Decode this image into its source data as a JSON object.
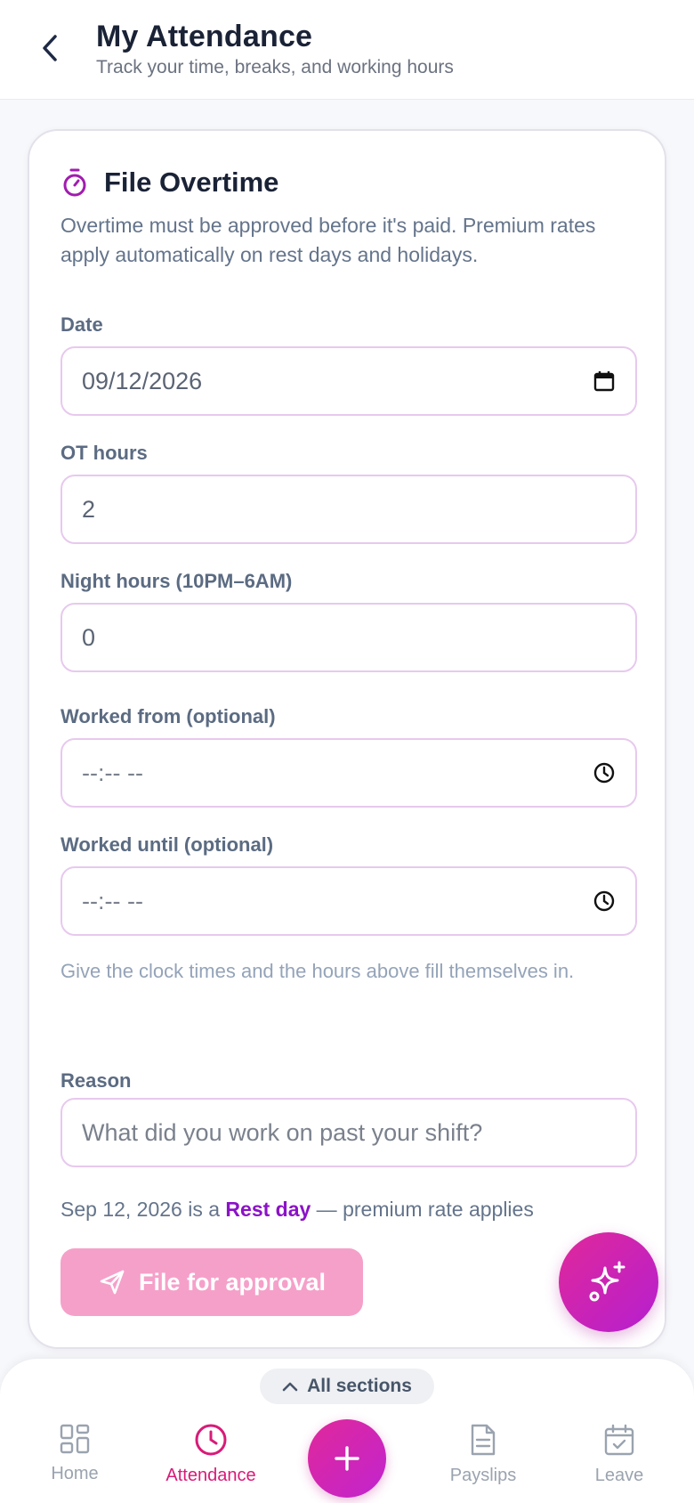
{
  "header": {
    "title": "My Attendance",
    "subtitle": "Track your time, breaks, and working hours"
  },
  "form": {
    "title": "File Overtime",
    "description": "Overtime must be approved before it's paid. Premium rates apply automatically on rest days and holidays.",
    "fields": {
      "date": {
        "label": "Date",
        "value": "09/12/2026"
      },
      "ot_hours": {
        "label": "OT hours",
        "value": "2"
      },
      "night_hours": {
        "label": "Night hours (10PM–6AM)",
        "value": "0"
      },
      "worked_from": {
        "label": "Worked from (optional)",
        "placeholder": "--:-- --"
      },
      "worked_until": {
        "label": "Worked until (optional)",
        "placeholder": "--:-- --"
      },
      "reason": {
        "label": "Reason",
        "placeholder": "What did you work on past your shift?"
      }
    },
    "helper_text": "Give the clock times and the hours above fill themselves in.",
    "rate_note": {
      "prefix": "Sep 12, 2026 is a ",
      "day_type": "Rest day",
      "suffix": " — premium rate applies"
    },
    "submit_label": "File for approval"
  },
  "bottom_nav": {
    "all_sections_label": "All sections",
    "items": [
      {
        "label": "Home",
        "icon": "grid-icon"
      },
      {
        "label": "Attendance",
        "icon": "clock-icon",
        "active": true
      },
      {
        "label": "Payslips",
        "icon": "document-icon"
      },
      {
        "label": "Leave",
        "icon": "calendar-check-icon"
      }
    ]
  },
  "colors": {
    "accent": "#d81b78",
    "rest_day": "#8b12c7",
    "submit_disabled": "#f5a0c9",
    "field_border": "#e7c9ee"
  }
}
